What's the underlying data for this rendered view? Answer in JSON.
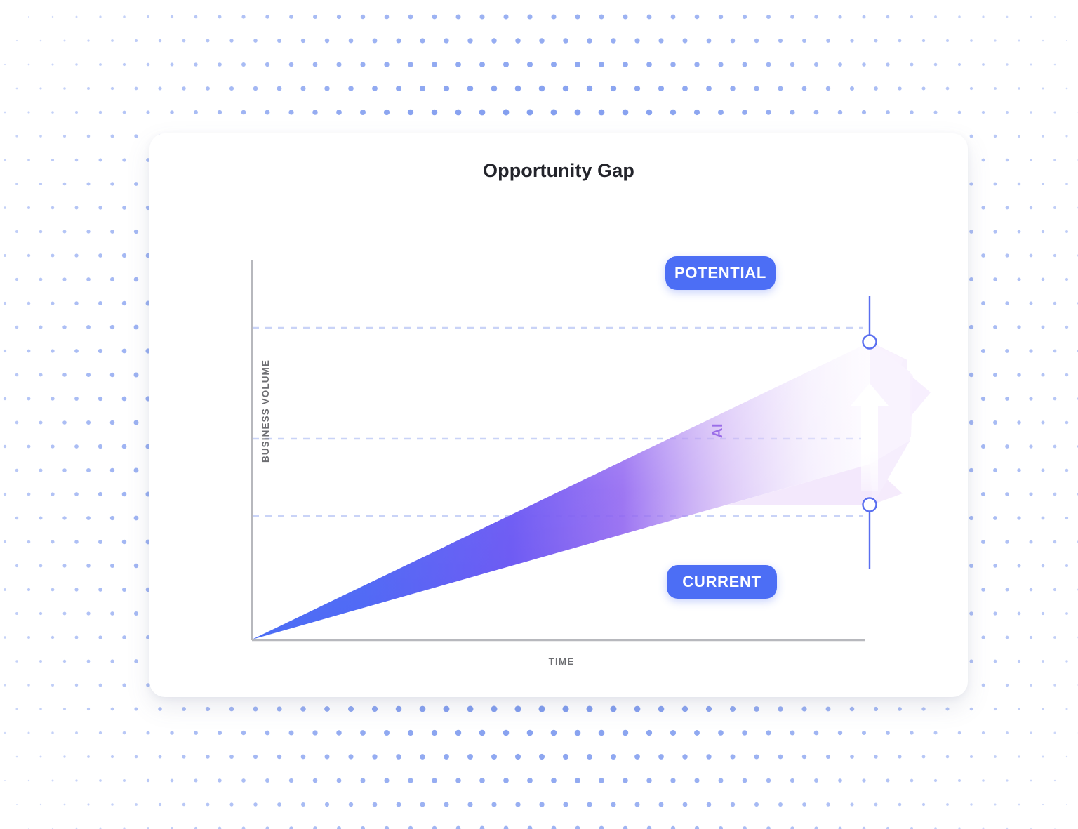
{
  "background": {
    "name": "halftone-dot-pattern",
    "dot_color": "#4a72e8",
    "base_color": "#ffffff"
  },
  "card": {
    "background": "#ffffff",
    "corner_radius_px": 22
  },
  "header": {
    "title": "Opportunity Gap"
  },
  "axes": {
    "y_label": "BUSINESS VOLUME",
    "x_label": "TIME",
    "axis_color": "#b7b8bd"
  },
  "annotations": {
    "potential_badge": "POTENTIAL",
    "current_badge": "CURRENT",
    "gap_arrow_label": "AI",
    "badge_color": "#4c6ef5",
    "badge_text_color": "#ffffff",
    "arrow_label_color": "#9b6ee8",
    "marker_color": "#5a6ff0"
  },
  "chart_data": {
    "type": "area",
    "title": "Opportunity Gap",
    "xlabel": "TIME",
    "ylabel": "BUSINESS VOLUME",
    "xlim": [
      0,
      100
    ],
    "ylim": [
      0,
      100
    ],
    "grid": true,
    "gridlines_y": [
      25,
      55,
      80
    ],
    "gridline_style": "dashed",
    "gridline_color": "#c9d3f7",
    "legend": "none",
    "series": [
      {
        "name": "Potential",
        "type": "line",
        "x": [
          0,
          100
        ],
        "values": [
          0,
          80
        ],
        "note": "upper bound of opportunity wedge"
      },
      {
        "name": "Current",
        "type": "line",
        "x": [
          0,
          100
        ],
        "values": [
          0,
          32
        ],
        "note": "lower bound of opportunity wedge"
      }
    ],
    "fill_between": {
      "name": "Opportunity Gap",
      "lower_series": "Current",
      "upper_series": "Potential",
      "gradient_from": "#4c6ef5",
      "gradient_mid": "#7b4ff0",
      "gradient_to": "#fdf7ff"
    },
    "markers": [
      {
        "label": "POTENTIAL",
        "x": 77,
        "y": 80
      },
      {
        "label": "CURRENT",
        "x": 77,
        "y": 25
      }
    ],
    "annotation_arrow": {
      "label": "AI",
      "x": 77,
      "from_y": 25,
      "to_y": 73,
      "direction": "up"
    }
  }
}
